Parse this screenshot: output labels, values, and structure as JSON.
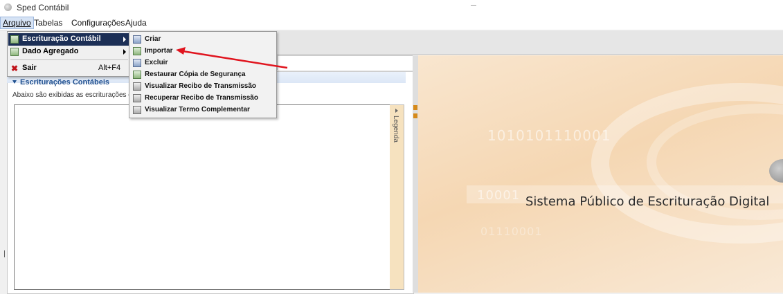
{
  "window": {
    "title": "Sped Contábil",
    "icon": "app-icon"
  },
  "menubar": {
    "items": [
      {
        "label": "Arquivo",
        "active": true
      },
      {
        "label": "Tabelas"
      },
      {
        "label": "Configurações"
      },
      {
        "label": "Ajuda"
      }
    ]
  },
  "file_menu": {
    "items": [
      {
        "label": "Escrituração Contábil",
        "icon": "book-icon",
        "submenu": true,
        "highlighted": true
      },
      {
        "label": "Dado Agregado",
        "icon": "data-icon",
        "submenu": true
      },
      {
        "label": "Sair",
        "icon": "close-icon",
        "shortcut": "Alt+F4"
      }
    ]
  },
  "escrituracao_submenu": {
    "items": [
      {
        "label": "Criar",
        "icon": "create-icon"
      },
      {
        "label": "Importar",
        "icon": "import-icon"
      },
      {
        "label": "Excluir",
        "icon": "delete-icon"
      },
      {
        "label": "Restaurar Cópia de Segurança",
        "icon": "restore-icon"
      },
      {
        "label": "Visualizar Recibo de Transmissão",
        "icon": "receipt-icon"
      },
      {
        "label": "Recuperar Recibo de Transmissão",
        "icon": "receipt-icon"
      },
      {
        "label": "Visualizar Termo Complementar",
        "icon": "receipt-icon"
      }
    ]
  },
  "main_panel": {
    "section_title": "Escriturações Contábeis",
    "description": "Abaixo são exibidas as escriturações co",
    "legend_label": "Legenda"
  },
  "banner": {
    "title": "Sistema Público de Escrituração Digital",
    "binary_1": "1010101110001",
    "binary_2": "10001",
    "binary_3": "01110001"
  },
  "colors": {
    "highlight": "#1c2f56",
    "annotation_arrow": "#e0141e",
    "banner_bg": "#f5d7b3"
  }
}
